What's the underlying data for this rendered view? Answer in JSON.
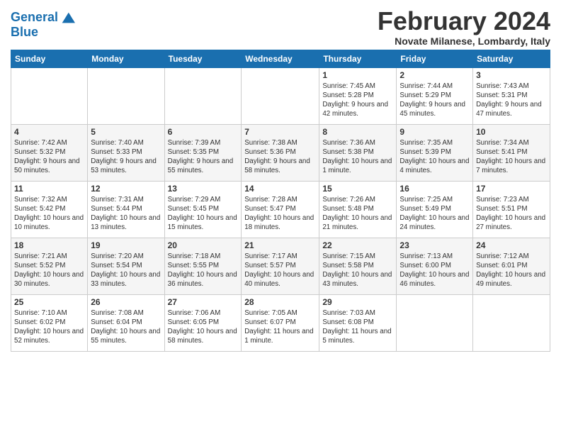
{
  "header": {
    "logo_line1": "General",
    "logo_line2": "Blue",
    "month_year": "February 2024",
    "location": "Novate Milanese, Lombardy, Italy"
  },
  "days_of_week": [
    "Sunday",
    "Monday",
    "Tuesday",
    "Wednesday",
    "Thursday",
    "Friday",
    "Saturday"
  ],
  "weeks": [
    [
      {
        "day": "",
        "info": ""
      },
      {
        "day": "",
        "info": ""
      },
      {
        "day": "",
        "info": ""
      },
      {
        "day": "",
        "info": ""
      },
      {
        "day": "1",
        "info": "Sunrise: 7:45 AM\nSunset: 5:28 PM\nDaylight: 9 hours and 42 minutes."
      },
      {
        "day": "2",
        "info": "Sunrise: 7:44 AM\nSunset: 5:29 PM\nDaylight: 9 hours and 45 minutes."
      },
      {
        "day": "3",
        "info": "Sunrise: 7:43 AM\nSunset: 5:31 PM\nDaylight: 9 hours and 47 minutes."
      }
    ],
    [
      {
        "day": "4",
        "info": "Sunrise: 7:42 AM\nSunset: 5:32 PM\nDaylight: 9 hours and 50 minutes."
      },
      {
        "day": "5",
        "info": "Sunrise: 7:40 AM\nSunset: 5:33 PM\nDaylight: 9 hours and 53 minutes."
      },
      {
        "day": "6",
        "info": "Sunrise: 7:39 AM\nSunset: 5:35 PM\nDaylight: 9 hours and 55 minutes."
      },
      {
        "day": "7",
        "info": "Sunrise: 7:38 AM\nSunset: 5:36 PM\nDaylight: 9 hours and 58 minutes."
      },
      {
        "day": "8",
        "info": "Sunrise: 7:36 AM\nSunset: 5:38 PM\nDaylight: 10 hours and 1 minute."
      },
      {
        "day": "9",
        "info": "Sunrise: 7:35 AM\nSunset: 5:39 PM\nDaylight: 10 hours and 4 minutes."
      },
      {
        "day": "10",
        "info": "Sunrise: 7:34 AM\nSunset: 5:41 PM\nDaylight: 10 hours and 7 minutes."
      }
    ],
    [
      {
        "day": "11",
        "info": "Sunrise: 7:32 AM\nSunset: 5:42 PM\nDaylight: 10 hours and 10 minutes."
      },
      {
        "day": "12",
        "info": "Sunrise: 7:31 AM\nSunset: 5:44 PM\nDaylight: 10 hours and 13 minutes."
      },
      {
        "day": "13",
        "info": "Sunrise: 7:29 AM\nSunset: 5:45 PM\nDaylight: 10 hours and 15 minutes."
      },
      {
        "day": "14",
        "info": "Sunrise: 7:28 AM\nSunset: 5:47 PM\nDaylight: 10 hours and 18 minutes."
      },
      {
        "day": "15",
        "info": "Sunrise: 7:26 AM\nSunset: 5:48 PM\nDaylight: 10 hours and 21 minutes."
      },
      {
        "day": "16",
        "info": "Sunrise: 7:25 AM\nSunset: 5:49 PM\nDaylight: 10 hours and 24 minutes."
      },
      {
        "day": "17",
        "info": "Sunrise: 7:23 AM\nSunset: 5:51 PM\nDaylight: 10 hours and 27 minutes."
      }
    ],
    [
      {
        "day": "18",
        "info": "Sunrise: 7:21 AM\nSunset: 5:52 PM\nDaylight: 10 hours and 30 minutes."
      },
      {
        "day": "19",
        "info": "Sunrise: 7:20 AM\nSunset: 5:54 PM\nDaylight: 10 hours and 33 minutes."
      },
      {
        "day": "20",
        "info": "Sunrise: 7:18 AM\nSunset: 5:55 PM\nDaylight: 10 hours and 36 minutes."
      },
      {
        "day": "21",
        "info": "Sunrise: 7:17 AM\nSunset: 5:57 PM\nDaylight: 10 hours and 40 minutes."
      },
      {
        "day": "22",
        "info": "Sunrise: 7:15 AM\nSunset: 5:58 PM\nDaylight: 10 hours and 43 minutes."
      },
      {
        "day": "23",
        "info": "Sunrise: 7:13 AM\nSunset: 6:00 PM\nDaylight: 10 hours and 46 minutes."
      },
      {
        "day": "24",
        "info": "Sunrise: 7:12 AM\nSunset: 6:01 PM\nDaylight: 10 hours and 49 minutes."
      }
    ],
    [
      {
        "day": "25",
        "info": "Sunrise: 7:10 AM\nSunset: 6:02 PM\nDaylight: 10 hours and 52 minutes."
      },
      {
        "day": "26",
        "info": "Sunrise: 7:08 AM\nSunset: 6:04 PM\nDaylight: 10 hours and 55 minutes."
      },
      {
        "day": "27",
        "info": "Sunrise: 7:06 AM\nSunset: 6:05 PM\nDaylight: 10 hours and 58 minutes."
      },
      {
        "day": "28",
        "info": "Sunrise: 7:05 AM\nSunset: 6:07 PM\nDaylight: 11 hours and 1 minute."
      },
      {
        "day": "29",
        "info": "Sunrise: 7:03 AM\nSunset: 6:08 PM\nDaylight: 11 hours and 5 minutes."
      },
      {
        "day": "",
        "info": ""
      },
      {
        "day": "",
        "info": ""
      }
    ]
  ]
}
